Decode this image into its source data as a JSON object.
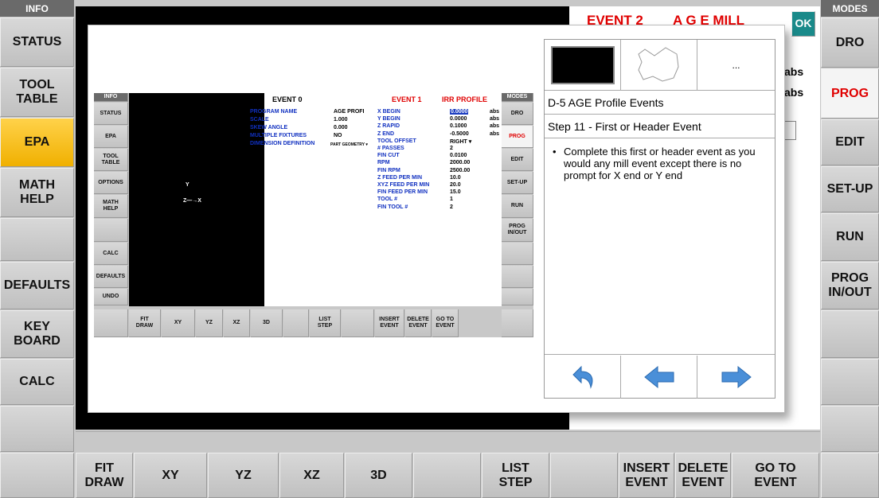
{
  "left_nav": {
    "header": "INFO",
    "items": [
      "STATUS",
      "TOOL\nTABLE",
      "EPA",
      "MATH\nHELP",
      "",
      "DEFAULTS",
      "KEY\nBOARD",
      "CALC",
      ""
    ]
  },
  "right_nav": {
    "header": "MODES",
    "items": [
      "DRO",
      "PROG",
      "EDIT",
      "SET-UP",
      "RUN",
      "PROG\nIN/OUT",
      "",
      "",
      ""
    ]
  },
  "bottom": [
    "FIT\nDRAW",
    "XY",
    "YZ",
    "XZ",
    "3D",
    "",
    "LIST\nSTEP",
    "",
    "INSERT\nEVENT",
    "DELETE\nEVENT",
    "GO TO\nEVENT"
  ],
  "bg": {
    "event_title": "EVENT 2",
    "event_name": "A G E  MILL",
    "ok": "OK",
    "abs1": "abs",
    "abs2": "abs"
  },
  "mini": {
    "left_header": "INFO",
    "left": [
      "STATUS",
      "EPA",
      "TOOL\nTABLE",
      "OPTIONS",
      "MATH\nHELP",
      "",
      "CALC",
      "DEFAULTS",
      "UNDO"
    ],
    "right_header": "MODES",
    "right": [
      "DRO",
      "PROG",
      "EDIT",
      "SET-UP",
      "RUN",
      "PROG\nIN/OUT",
      "",
      "",
      ""
    ],
    "bottom": [
      "FIT\nDRAW",
      "XY",
      "YZ",
      "XZ",
      "3D",
      "",
      "LIST\nSTEP",
      "",
      "INSERT\nEVENT",
      "DELETE\nEVENT",
      "GO TO\nEVENT"
    ],
    "axis_y": "Y",
    "axis_zx": "Z—→X",
    "event0": {
      "title": "EVENT 0",
      "rows": [
        [
          "PROGRAM NAME",
          "AGE PROFI"
        ],
        [
          "SCALE",
          "1.000"
        ],
        [
          "SKEW ANGLE",
          "0.000"
        ],
        [
          "MULTIPLE FIXTURES",
          "NO"
        ],
        [
          "DIMENSION DEFINITION",
          "PART GEOMETRY ▾"
        ]
      ]
    },
    "event1": {
      "title": "EVENT 1",
      "name": "IRR PROFILE",
      "rows": [
        [
          "X BEGIN",
          "0.0000",
          "abs"
        ],
        [
          "Y BEGIN",
          "0.0000",
          "abs"
        ],
        [
          "Z RAPID",
          "0.1000",
          "abs"
        ],
        [
          "Z END",
          "-0.5000",
          "abs"
        ],
        [
          "TOOL OFFSET",
          "RIGHT ▾",
          ""
        ],
        [
          "# PASSES",
          "2",
          ""
        ],
        [
          "FIN CUT",
          "0.0100",
          ""
        ],
        [
          "RPM",
          "2000.00",
          ""
        ],
        [
          "FIN RPM",
          "2500.00",
          ""
        ],
        [
          "Z FEED PER MIN",
          "10.0",
          ""
        ],
        [
          "XYZ FEED PER MIN",
          "20.0",
          ""
        ],
        [
          "FIN FEED PER MIN",
          "15.0",
          ""
        ],
        [
          "TOOL #",
          "1",
          ""
        ],
        [
          "FIN TOOL #",
          "2",
          ""
        ]
      ]
    }
  },
  "help": {
    "title": "D-5 AGE Profile Events",
    "step": "Step 11 - First or Header Event",
    "thumb3": "...",
    "bullet": "Complete this first or header event as you would any mill event except there is no prompt for X end or Y end"
  },
  "colors": {
    "accent_red": "#e00000",
    "active_yellow": "#f5bd10",
    "ok_teal": "#1a8a8a",
    "arrow_blue": "#4a8fd8"
  }
}
